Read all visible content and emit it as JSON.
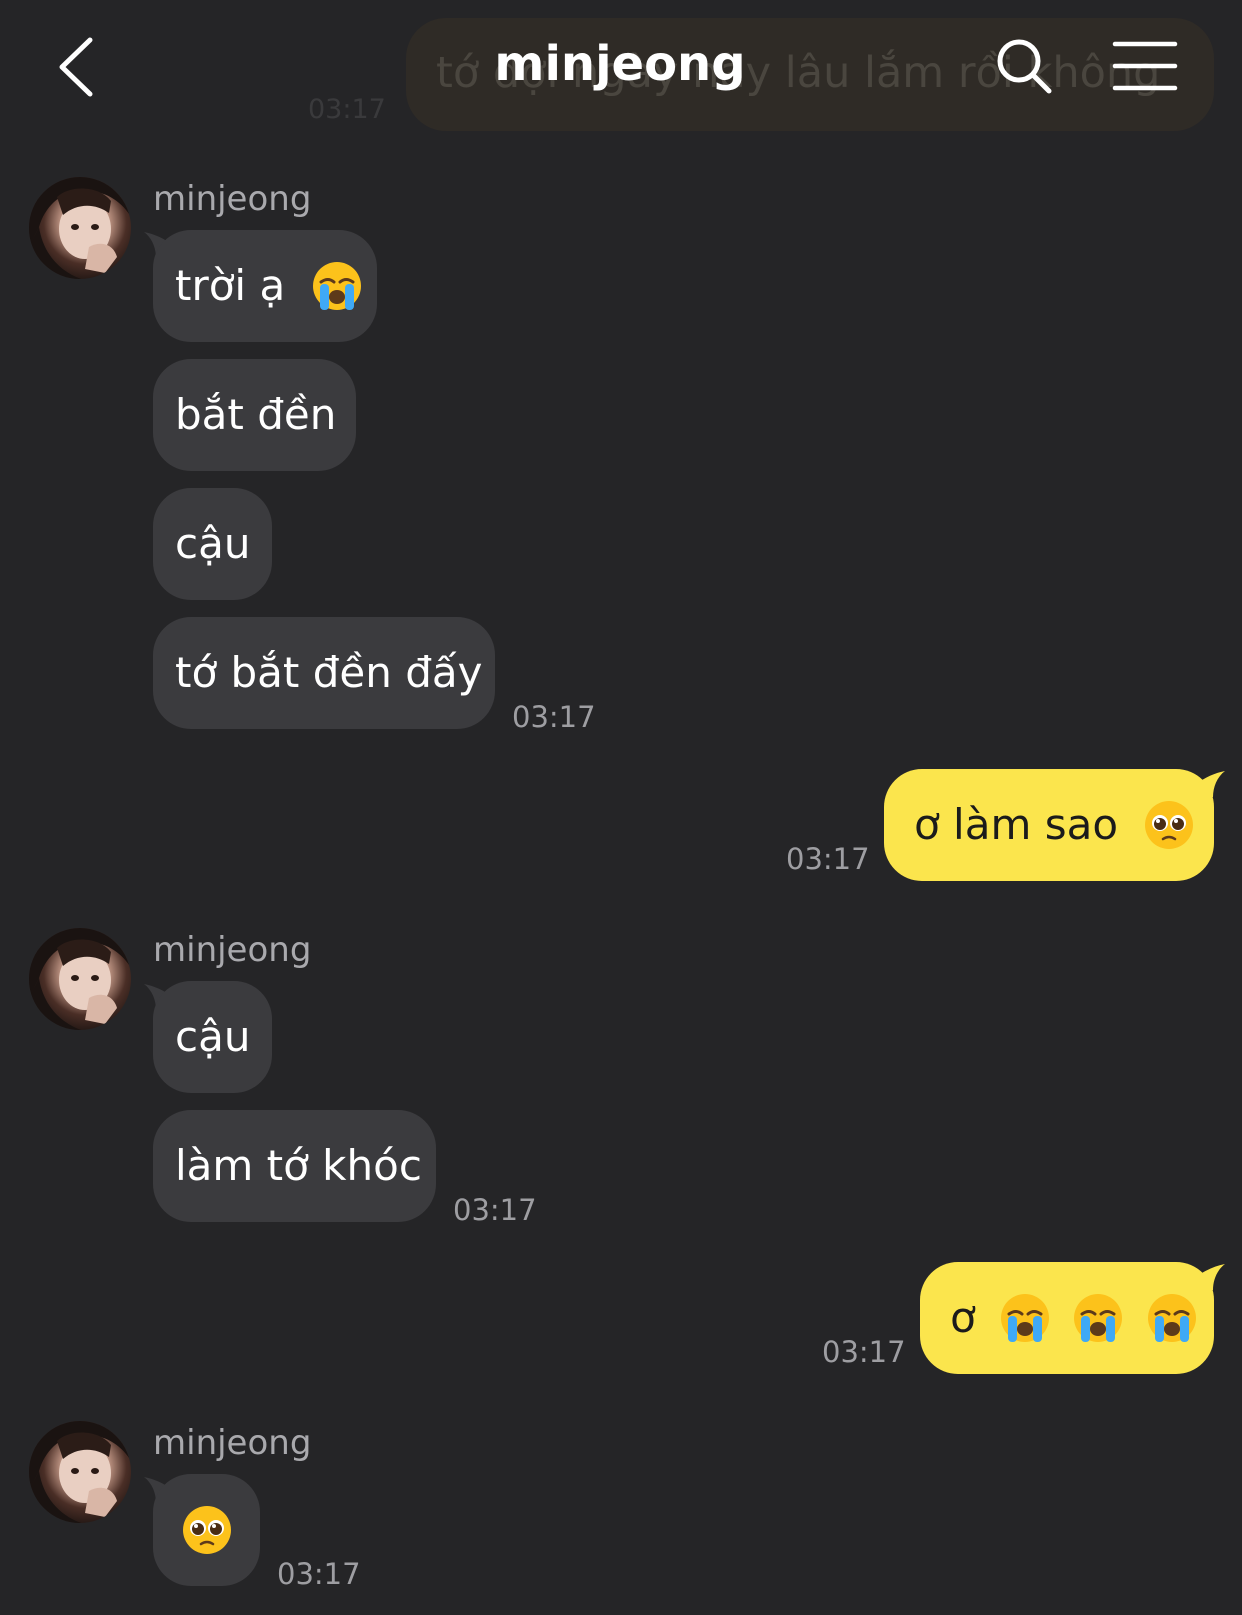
{
  "header": {
    "title": "minjeong",
    "back_icon": "chevron-left-icon",
    "search_icon": "search-icon",
    "menu_icon": "hamburger-menu-icon",
    "behind_preview_text": "tớ đợi ngày này lâu lắm rồi không",
    "behind_preview_time": "03:17"
  },
  "colors": {
    "background": "#252527",
    "incoming_bubble": "#3b3b3e",
    "outgoing_bubble": "#fbe54d",
    "timestamp": "#9e9ea2"
  },
  "messages": {
    "group1": {
      "sender": "minjeong",
      "m1": "trời ạ",
      "m2": "bắt đền",
      "m3": "cậu",
      "m4": "tớ bắt đền đấy",
      "time": "03:17"
    },
    "out1": {
      "text": "ơ làm sao",
      "emoji": "pleading-face-emoji",
      "time": "03:17"
    },
    "group2": {
      "sender": "minjeong",
      "m1": "cậu",
      "m2": "làm tớ khóc",
      "time": "03:17"
    },
    "out2": {
      "text": "ơ",
      "emoji": "loudly-crying-face-emoji",
      "emoji_count": 3,
      "time": "03:17"
    },
    "group3": {
      "sender": "minjeong",
      "emoji": "pleading-face-emoji",
      "time": "03:17"
    }
  }
}
